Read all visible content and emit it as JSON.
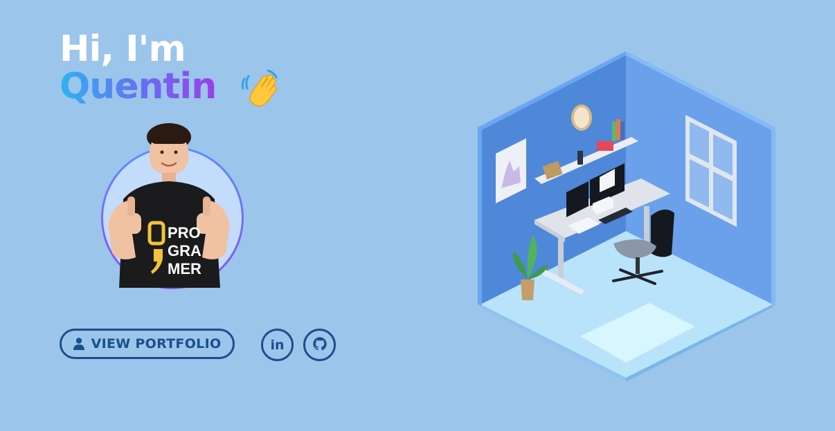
{
  "hero": {
    "greeting": "Hi, I'm",
    "name": "Quentin"
  },
  "avatar": {
    "shirt_text": [
      "PRO",
      "GRA",
      "MER"
    ]
  },
  "actions": {
    "portfolio_label": "VIEW PORTFOLIO",
    "linkedin_label": "in"
  },
  "colors": {
    "background": "#9bc5eb",
    "accent": "#1a4f8c",
    "name_gradient": [
      "#2fb2f2",
      "#6a6cf0",
      "#9b3fe8"
    ]
  },
  "icons": [
    "waving-hand-icon",
    "user-icon",
    "linkedin-icon",
    "github-icon"
  ]
}
